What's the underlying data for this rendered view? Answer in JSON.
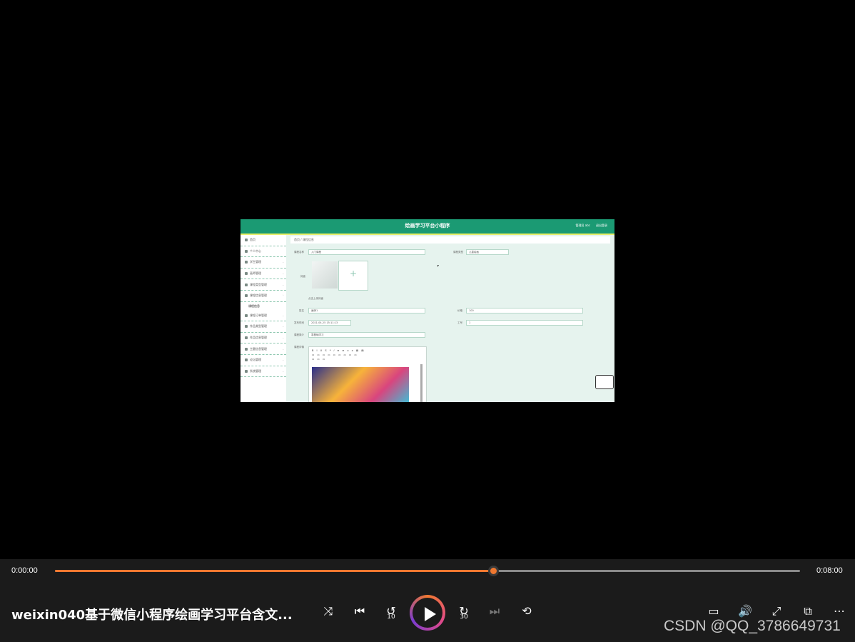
{
  "app": {
    "title": "绘画学习平台小程序",
    "user": "管理员 abc",
    "logout": "退出登录",
    "breadcrumb": "首页 / 课程信息",
    "sidebar": [
      "首页",
      "个人中心",
      "学生管理",
      "画师管理",
      "课程类型管理",
      "课程信息管理",
      "课程订单管理",
      "作品类型管理",
      "作品信息管理",
      "主题信息管理",
      "论坛管理",
      "系统管理"
    ],
    "sidebar_sub": "课程信息",
    "form": {
      "course_name_label": "课程名称",
      "course_name_value": "入门课程",
      "course_type_label": "课程类型",
      "course_type_value": "儿童绘画",
      "cover_label": "封面",
      "upload_hint": "点击上传封面",
      "name_label": "姓名",
      "name_value": "画师1",
      "price_label": "价格",
      "price_value": "100",
      "time_label": "发布时间",
      "time_value": "2021-04-25 15:11:13",
      "number_label": "工号",
      "number_value": "1",
      "brief_label": "课程简介",
      "brief_value": "零基础学习",
      "detail_label": "课程详情"
    }
  },
  "player": {
    "current_time": "0:00:00",
    "duration": "0:08:00",
    "progress_fraction": 0.588,
    "title": "weixin040基于微信小程序绘画学习平台含文...",
    "skip_back": "10",
    "skip_forward": "30",
    "watermark": "CSDN @QQ_3786649731",
    "accent_color": "#f07830"
  }
}
